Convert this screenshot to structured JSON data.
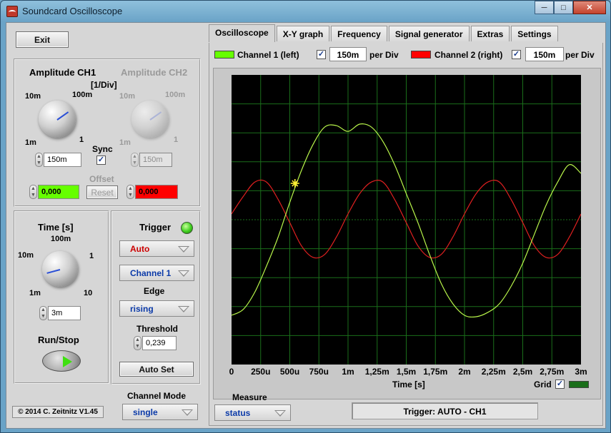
{
  "window": {
    "title": "Soundcard Oscilloscope",
    "minimize_icon": "minimize-icon",
    "maximize_icon": "maximize-icon",
    "close_icon": "close-icon"
  },
  "left": {
    "exit_label": "Exit",
    "amp_ch1_title": "Amplitude CH1",
    "amp_ch2_title": "Amplitude CH2",
    "amp_unit": "[1/Div]",
    "knob_labels": {
      "s10m": "10m",
      "s100m": "100m",
      "s1m": "1m",
      "s1": "1"
    },
    "ch1_value": "150m",
    "ch2_value": "150m",
    "sync_label": "Sync",
    "sync_checked": true,
    "offset_label": "Offset",
    "reset_label": "Reset",
    "offset_ch1": "0,000",
    "offset_ch2": "0,000",
    "offset_ch1_color": "#66ff00",
    "offset_ch2_color": "#ff0000",
    "time_title": "Time [s]",
    "time_knob_labels": {
      "s100m": "100m",
      "s10m": "10m",
      "s1": "1",
      "s1m": "1m",
      "s10": "10"
    },
    "time_value": "3m",
    "run_stop_label": "Run/Stop",
    "play_icon": "play-icon",
    "copyright": "© 2014  C. Zeitnitz V1.45"
  },
  "trigger": {
    "title": "Trigger",
    "mode": "Auto",
    "mode_color": "#cc0000",
    "channel": "Channel 1",
    "edge_label": "Edge",
    "edge": "rising",
    "threshold_label": "Threshold",
    "threshold": "0,239",
    "autoset_label": "Auto Set",
    "led_state": "on"
  },
  "channel_mode": {
    "label": "Channel Mode",
    "value": "single"
  },
  "tabs": [
    "Oscilloscope",
    "X-Y graph",
    "Frequency",
    "Signal generator",
    "Extras",
    "Settings"
  ],
  "active_tab": "Oscilloscope",
  "scope_header": {
    "ch1_label": "Channel 1 (left)",
    "ch1_color": "#66ff00",
    "ch1_enabled": true,
    "ch1_div": "150m",
    "per_div": "per Div",
    "ch2_label": "Channel 2 (right)",
    "ch2_color": "#ff0000",
    "ch2_enabled": true,
    "ch2_div": "150m"
  },
  "graph": {
    "x_ticks": [
      "0",
      "250u",
      "500u",
      "750u",
      "1m",
      "1,25m",
      "1,5m",
      "1,75m",
      "2m",
      "2,25m",
      "2,5m",
      "2,75m",
      "3m"
    ],
    "x_label": "Time [s]",
    "grid_label": "Grid",
    "grid_on": true,
    "grid_color": "#1a6e1a",
    "trigger_marker_icon": "trigger-marker-icon"
  },
  "chart_data": {
    "type": "line",
    "xlabel": "Time [s]",
    "ylabel": "",
    "xlim": [
      0,
      0.003
    ],
    "ylim": [
      -5,
      5
    ],
    "grid": true,
    "x": [
      0,
      0.0001,
      0.0002,
      0.0003,
      0.0004,
      0.0005,
      0.0006,
      0.0007,
      0.0008,
      0.0009,
      0.001,
      0.0011,
      0.0012,
      0.0013,
      0.0014,
      0.0015,
      0.0016,
      0.0017,
      0.0018,
      0.0019,
      0.002,
      0.0021,
      0.0022,
      0.0023,
      0.0024,
      0.0025,
      0.0026,
      0.0027,
      0.0028,
      0.0029,
      0.003
    ],
    "series": [
      {
        "name": "Channel 1 (left)",
        "color": "#b8f54a",
        "values": [
          -3.3,
          -3.1,
          -2.5,
          -1.6,
          -0.6,
          0.6,
          1.7,
          2.6,
          3.2,
          3.25,
          3.05,
          3.3,
          3.2,
          2.7,
          1.9,
          0.9,
          -0.1,
          -1.2,
          -2.2,
          -2.9,
          -3.3,
          -3.35,
          -3.2,
          -2.9,
          -2.3,
          -1.5,
          -0.5,
          0.5,
          1.3,
          1.9,
          1.6
        ]
      },
      {
        "name": "Channel 2 (right)",
        "color": "#e02020",
        "values": [
          0.2,
          0.8,
          1.3,
          1.3,
          0.7,
          -0.1,
          -0.9,
          -1.3,
          -1.2,
          -0.6,
          0.2,
          0.9,
          1.3,
          1.3,
          0.7,
          -0.1,
          -0.9,
          -1.3,
          -1.2,
          -0.6,
          0.2,
          0.9,
          1.3,
          1.3,
          0.7,
          -0.1,
          -0.9,
          -1.3,
          -1.2,
          -0.6,
          0.2
        ]
      }
    ]
  },
  "bottom": {
    "measure_label": "Measure",
    "measure_value": "status",
    "status_text": "Trigger: AUTO - CH1"
  }
}
